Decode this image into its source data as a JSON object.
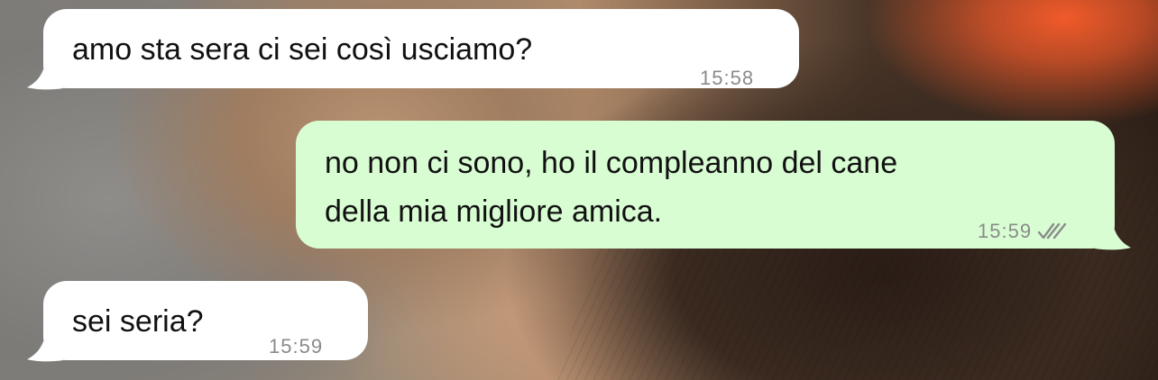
{
  "chat": {
    "messages": [
      {
        "direction": "incoming",
        "text": "amo sta sera ci sei così usciamo?",
        "time": "15:58"
      },
      {
        "direction": "outgoing",
        "text_lines": [
          "no non ci sono, ho il compleanno del cane",
          "della mia migliore amica."
        ],
        "time": "15:59",
        "status_icon": "double-check-icon"
      },
      {
        "direction": "incoming",
        "text": "sei seria?",
        "time": "15:59"
      }
    ]
  },
  "colors": {
    "incoming_bubble": "#ffffff",
    "outgoing_bubble": "#d9fdd3",
    "text": "#111111",
    "timestamp": "#8a8a8a"
  }
}
